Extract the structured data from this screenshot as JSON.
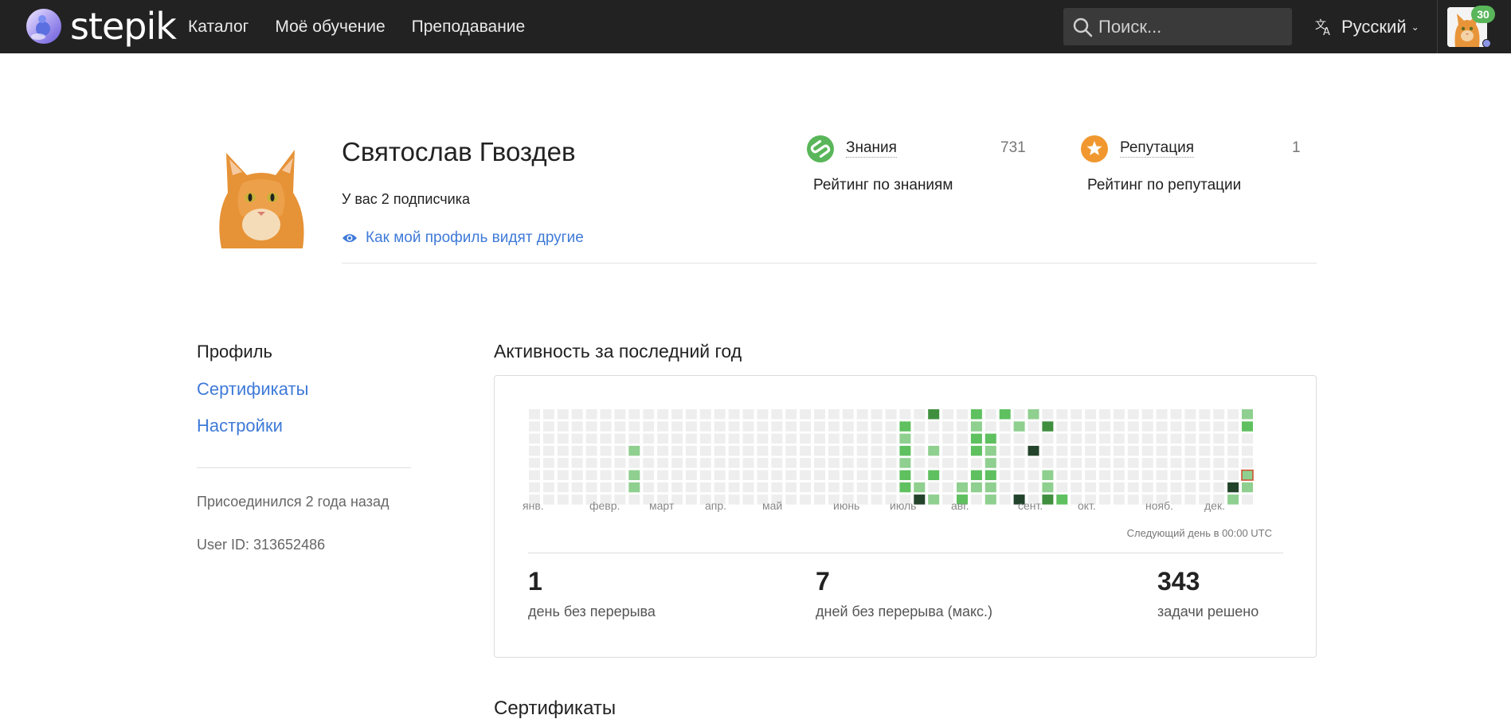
{
  "app": {
    "logo_text": "stepik"
  },
  "nav": {
    "items": [
      "Каталог",
      "Моё обучение",
      "Преподавание"
    ]
  },
  "search": {
    "placeholder": "Поиск..."
  },
  "language": {
    "label": "Русский"
  },
  "user_menu": {
    "badge_count": "30"
  },
  "profile": {
    "name": "Святослав Гвоздев",
    "subscribers": "У вас 2 подписчика",
    "visibility_link": "Как мой профиль видят другие"
  },
  "stats": {
    "knowledge": {
      "title": "Знания",
      "value": "731",
      "subtitle": "Рейтинг по знаниям",
      "icon": "stepik-s-icon",
      "color": "#59b65a"
    },
    "reputation": {
      "title": "Репутация",
      "value": "1",
      "subtitle": "Рейтинг по репутации",
      "icon": "star-icon",
      "color": "#f0982f"
    }
  },
  "sidebar": {
    "items": [
      {
        "label": "Профиль",
        "active": true
      },
      {
        "label": "Сертификаты",
        "active": false
      },
      {
        "label": "Настройки",
        "active": false
      }
    ],
    "joined": "Присоединился 2 года назад",
    "user_id": "User ID: 313652486"
  },
  "activity": {
    "title": "Активность за последний год",
    "months": [
      "янв.",
      "февр.",
      "март",
      "апр.",
      "май",
      "июнь",
      "июль",
      "авг.",
      "сент.",
      "окт.",
      "нояб.",
      "дек."
    ],
    "next_day": "Следующий день в 00:00 UTC",
    "levels": [
      "#eeeeee",
      "#8fcf8f",
      "#5fc05f",
      "#3f8f3f",
      "#23432a"
    ],
    "active_cells": [
      [
        7,
        3,
        1
      ],
      [
        7,
        5,
        1
      ],
      [
        7,
        6,
        1
      ],
      [
        26,
        1,
        2
      ],
      [
        26,
        2,
        1
      ],
      [
        26,
        3,
        2
      ],
      [
        26,
        4,
        1
      ],
      [
        26,
        5,
        2
      ],
      [
        26,
        6,
        2
      ],
      [
        27,
        6,
        1
      ],
      [
        27,
        7,
        4
      ],
      [
        28,
        0,
        3
      ],
      [
        28,
        3,
        1
      ],
      [
        28,
        5,
        2
      ],
      [
        28,
        7,
        1
      ],
      [
        30,
        6,
        1
      ],
      [
        30,
        7,
        2
      ],
      [
        31,
        0,
        2
      ],
      [
        31,
        1,
        1
      ],
      [
        31,
        2,
        2
      ],
      [
        31,
        3,
        2
      ],
      [
        31,
        5,
        2
      ],
      [
        31,
        6,
        1
      ],
      [
        32,
        2,
        2
      ],
      [
        32,
        3,
        1
      ],
      [
        32,
        4,
        1
      ],
      [
        32,
        5,
        2
      ],
      [
        32,
        6,
        1
      ],
      [
        32,
        7,
        1
      ],
      [
        33,
        0,
        2
      ],
      [
        34,
        1,
        1
      ],
      [
        34,
        7,
        4
      ],
      [
        35,
        0,
        1
      ],
      [
        35,
        3,
        4
      ],
      [
        36,
        1,
        3
      ],
      [
        36,
        5,
        1
      ],
      [
        36,
        6,
        1
      ],
      [
        36,
        7,
        3
      ],
      [
        37,
        7,
        2
      ],
      [
        49,
        6,
        4
      ],
      [
        49,
        7,
        1
      ],
      [
        50,
        0,
        1
      ],
      [
        50,
        1,
        2
      ],
      [
        50,
        6,
        1
      ]
    ],
    "today_cell": [
      50,
      5
    ],
    "metrics": [
      {
        "value": "1",
        "label": "день без перерыва"
      },
      {
        "value": "7",
        "label": "дней без перерыва (макс.)"
      },
      {
        "value": "343",
        "label": "задачи решено"
      }
    ]
  },
  "certificates": {
    "title": "Сертификаты"
  }
}
